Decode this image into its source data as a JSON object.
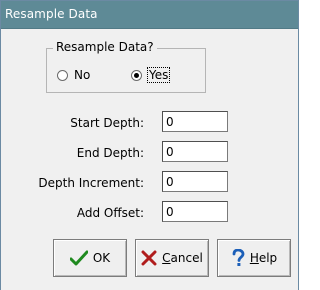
{
  "window": {
    "title": "Resample Data"
  },
  "resample_group": {
    "legend": "Resample Data?",
    "options": [
      {
        "label": "No",
        "checked": false
      },
      {
        "label": "Yes",
        "checked": true
      }
    ]
  },
  "fields": [
    {
      "label": "Start Depth:",
      "value": "0"
    },
    {
      "label": "End Depth:",
      "value": "0"
    },
    {
      "label": "Depth Increment:",
      "value": "0"
    },
    {
      "label": "Add Offset:",
      "value": "0"
    }
  ],
  "buttons": {
    "ok": {
      "label": "OK",
      "icon": "checkmark-icon",
      "color": "#1f8a1f"
    },
    "cancel": {
      "label": "Cancel",
      "icon": "x-icon",
      "color": "#b01c1c"
    },
    "help": {
      "label": "Help",
      "icon": "question-icon",
      "color": "#1c5fb8"
    }
  }
}
